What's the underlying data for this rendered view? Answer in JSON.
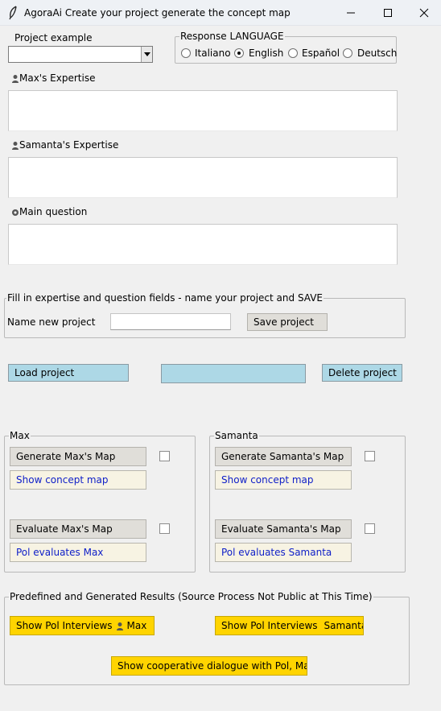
{
  "window": {
    "title": "AgoraAi  Create your project generate the concept map"
  },
  "project_example": {
    "label": "Project example",
    "value": ""
  },
  "language": {
    "group_title": "Response LANGUAGE",
    "options": [
      "Italiano",
      "English",
      "Español",
      "Deutsch"
    ],
    "selected": "English"
  },
  "fields": {
    "max_expertise_label": "Max's Expertise",
    "samanta_expertise_label": "Samanta's Expertise",
    "main_question_label": "Main question"
  },
  "save_group": {
    "title": "Fill in expertise and question fields - name your project and SAVE",
    "name_label": "Name new project",
    "name_value": "",
    "save_label": "Save project"
  },
  "project_actions": {
    "load_label": "Load project",
    "middle_label": "",
    "delete_label": "Delete project"
  },
  "max_panel": {
    "title": "Max",
    "generate_label": "Generate Max's Map",
    "show_label": "Show concept map",
    "evaluate_label": "Evaluate Max's Map",
    "pol_label": "Pol evaluates Max"
  },
  "samanta_panel": {
    "title": "Samanta",
    "generate_label": "Generate Samanta's Map",
    "show_label": "Show concept map",
    "evaluate_label": "Evaluate Samanta's Map",
    "pol_label": "Pol evaluates Samanta"
  },
  "results": {
    "title": "Predefined and Generated Results (Source Process Not Public at This Time)",
    "interviews_max_prefix": "Show Pol Interviews",
    "interviews_max_suffix": "Max",
    "interviews_samanta_prefix": "Show Pol Interviews",
    "interviews_samanta_suffix": "Samanta",
    "dialogue_label": "Show cooperative dialogue with Pol, Max, a"
  },
  "colors": {
    "blue_button": "#add8e6",
    "gold_button": "#ffd400",
    "cream_button": "#f7f3e3",
    "link_text": "#1020c8"
  }
}
